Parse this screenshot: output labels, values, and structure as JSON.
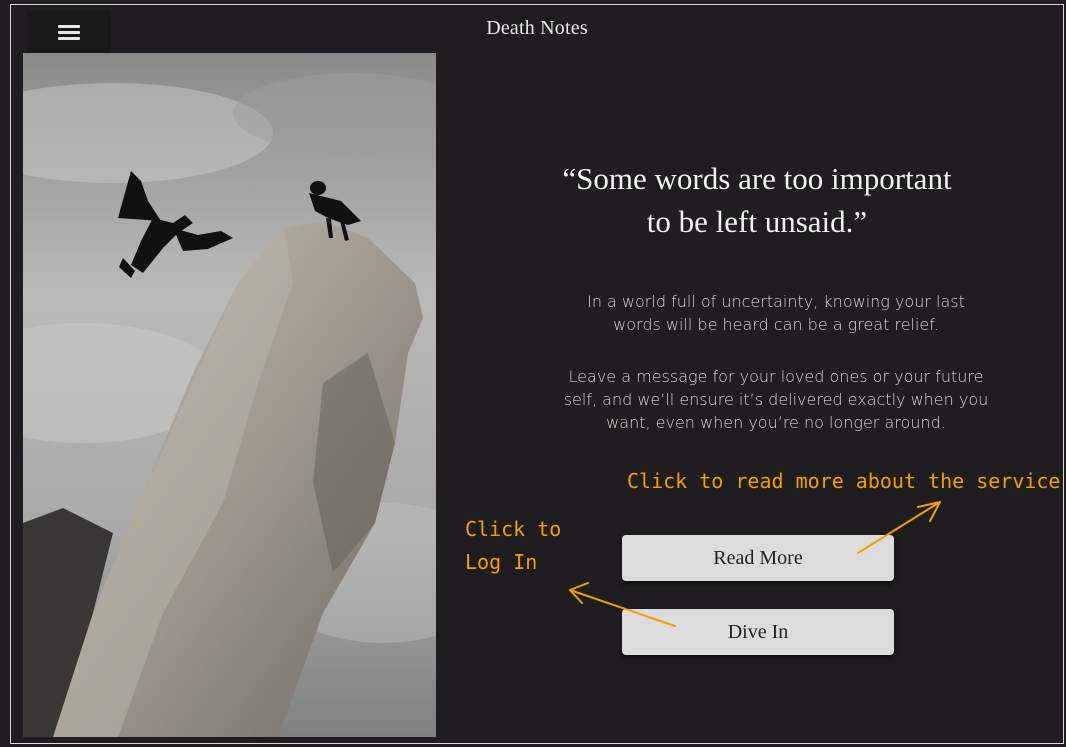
{
  "header": {
    "title": "Death Notes",
    "menu_icon": "hamburger-menu-icon"
  },
  "hero": {
    "quote_line1": "“Some words are too important",
    "quote_line2": "to be left unsaid.”",
    "paragraph1": "In a world full of uncertainty, knowing your last words will be heard can be a great relief.",
    "paragraph2": "Leave a message for your loved ones or your future self, and we’ll ensure it’s delivered exactly when you want, even when you’re no longer around."
  },
  "buttons": {
    "read_more": "Read More",
    "dive_in": "Dive In"
  },
  "annotations": {
    "read_more_hint": "Click to read more about the service",
    "login_hint_line1": "Click to",
    "login_hint_line2": "Log In",
    "color": "#f0a000"
  },
  "colors": {
    "background": "#1f1d1f",
    "button_bg": "#dcdcdc",
    "text": "#e8e6e6"
  }
}
